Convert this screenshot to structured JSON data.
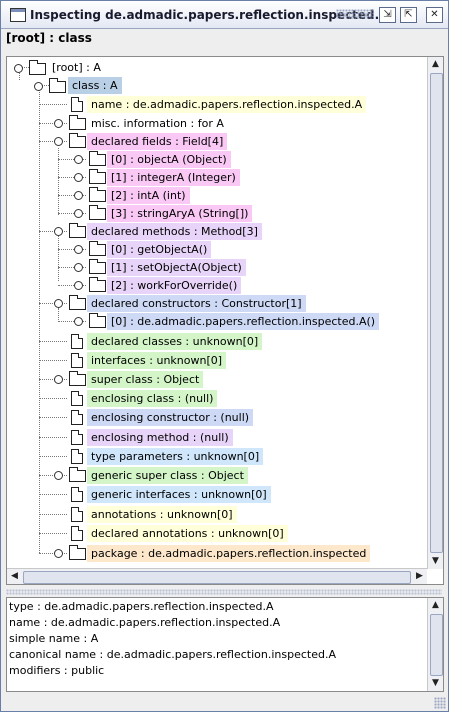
{
  "window": {
    "title": "Inspecting de.admadic.papers.reflection.inspected.A",
    "buttons": {
      "iconify": "⇲",
      "maximize": "⇱",
      "close": "✕"
    }
  },
  "breadcrumb": "[root] : class",
  "tree": {
    "root": "[root] : A",
    "class_node": "class : A",
    "name": "name : de.admadic.papers.reflection.inspected.A",
    "misc": "misc. information : for A",
    "declared_fields": "declared fields : Field[4]",
    "fields": [
      "[0] : objectA (Object)",
      "[1] : integerA (Integer)",
      "[2] : intA (int)",
      "[3] : stringAryA (String[])"
    ],
    "declared_methods": "declared methods : Method[3]",
    "methods": [
      "[0] : getObjectA()",
      "[1] : setObjectA(Object)",
      "[2] : workForOverride()"
    ],
    "declared_constructors": "declared constructors : Constructor[1]",
    "constructors": [
      "[0] : de.admadic.papers.reflection.inspected.A()"
    ],
    "declared_classes": "declared classes : unknown[0]",
    "interfaces": "interfaces : unknown[0]",
    "super_class": "super class : Object",
    "enclosing_class": "enclosing class : (null)",
    "enclosing_constructor": "enclosing constructor : (null)",
    "enclosing_method": "enclosing method : (null)",
    "type_parameters": "type parameters : unknown[0]",
    "generic_super_class": "generic super class : Object",
    "generic_interfaces": "generic interfaces : unknown[0]",
    "annotations": "annotations : unknown[0]",
    "declared_annotations": "declared annotations : unknown[0]",
    "package": "package : de.admadic.papers.reflection.inspected"
  },
  "colors": {
    "selected": "#b8cfe5",
    "yellow": "#ffffd9",
    "pink": "#f9c8f4",
    "lavender": "#e8d4f8",
    "blue": "#cdd9f5",
    "green": "#d3f5c8",
    "light_blue": "#cfe6fb",
    "orange": "#fde8cc"
  },
  "details": [
    "type : de.admadic.papers.reflection.inspected.A",
    "name : de.admadic.papers.reflection.inspected.A",
    "simple name : A",
    "canonical name : de.admadic.papers.reflection.inspected.A",
    "modifiers : public"
  ],
  "scrollbars": {
    "up": "▲",
    "down": "▼",
    "left": "◀",
    "right": "▶"
  }
}
